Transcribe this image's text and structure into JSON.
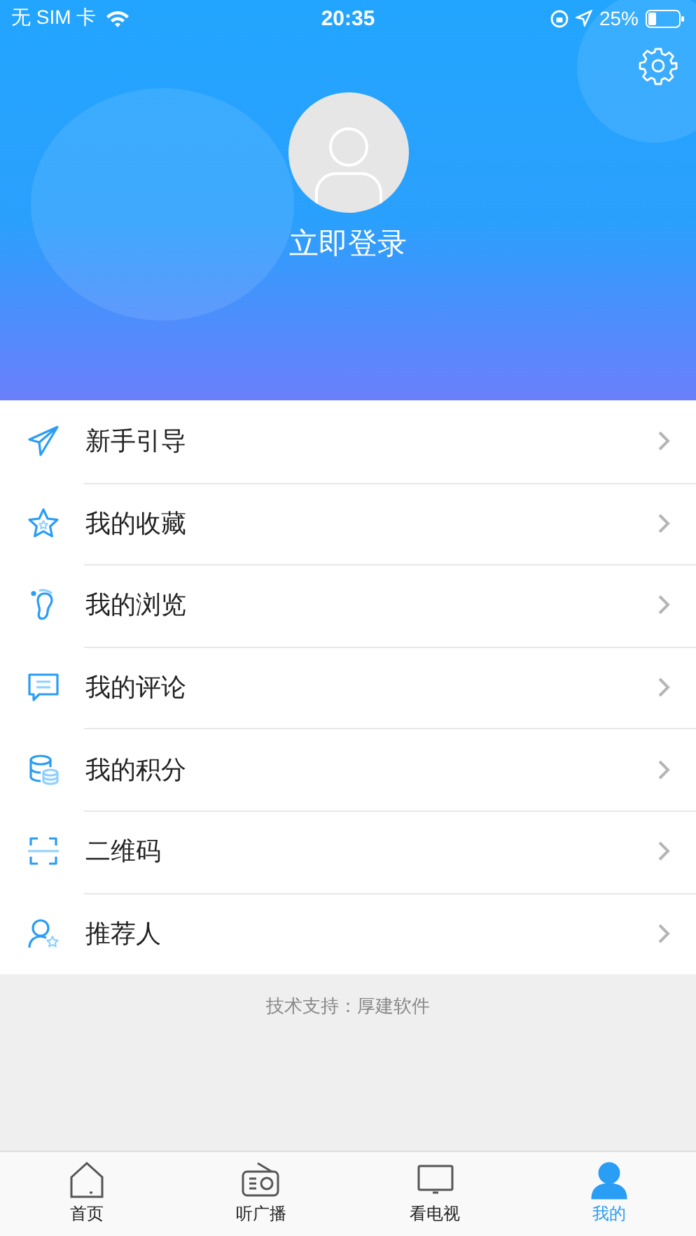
{
  "status_bar": {
    "carrier": "无 SIM 卡",
    "time": "20:35",
    "battery": "25%"
  },
  "profile": {
    "login": "立即登录"
  },
  "menu": [
    {
      "kind": "guide",
      "label": "新手引导"
    },
    {
      "kind": "favorite",
      "label": "我的收藏"
    },
    {
      "kind": "history",
      "label": "我的浏览"
    },
    {
      "kind": "comment",
      "label": "我的评论"
    },
    {
      "kind": "points",
      "label": "我的积分"
    },
    {
      "kind": "qrcode",
      "label": "二维码"
    },
    {
      "kind": "referrer",
      "label": "推荐人"
    }
  ],
  "footer": "技术支持：厚建软件",
  "tabs": [
    {
      "kind": "home",
      "label": "首页",
      "selected": false
    },
    {
      "kind": "radio",
      "label": "听广播",
      "selected": false
    },
    {
      "kind": "tv",
      "label": "看电视",
      "selected": false
    },
    {
      "kind": "me",
      "label": "我的",
      "selected": true
    }
  ]
}
